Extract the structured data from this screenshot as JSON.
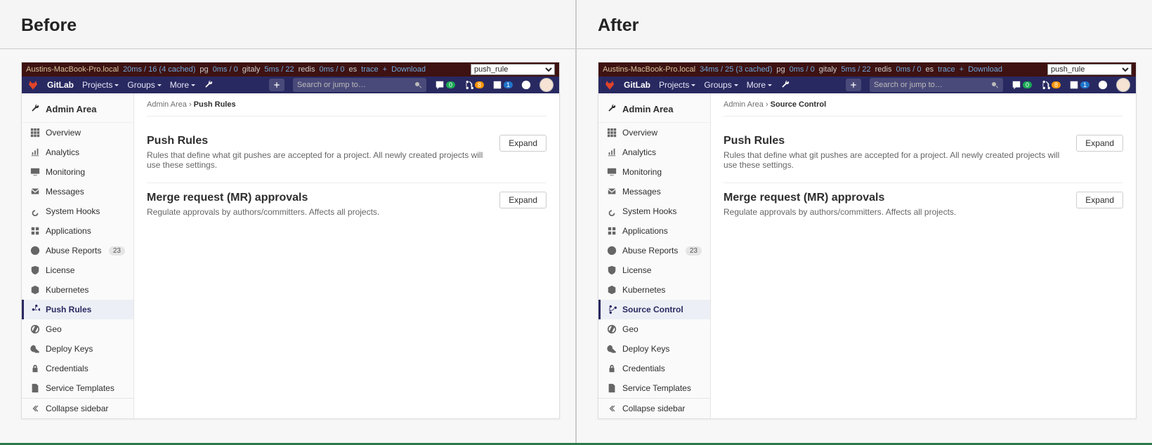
{
  "labels": {
    "before": "Before",
    "after": "After"
  },
  "perf": {
    "host": "Austins-MacBook-Pro.local",
    "before_metrics": "20ms / 16 (4 cached)",
    "after_metrics": "34ms / 25 (3 cached)",
    "pg": "pg",
    "pg_ms": "0ms / 0",
    "gitaly": "gitaly",
    "gitaly_ms": "5ms / 22",
    "redis": "redis",
    "redis_ms": "0ms / 0",
    "es": "es",
    "trace": "trace",
    "plus": "+",
    "download": "Download",
    "combo": "push_rule"
  },
  "nav": {
    "brand": "GitLab",
    "projects": "Projects",
    "groups": "Groups",
    "more": "More",
    "search_placeholder": "Search or jump to…",
    "issues_badge": "0",
    "mr_badge": "8",
    "todos_badge": "1"
  },
  "sidebar": {
    "head": "Admin Area",
    "overview": "Overview",
    "analytics": "Analytics",
    "monitoring": "Monitoring",
    "messages": "Messages",
    "system_hooks": "System Hooks",
    "applications": "Applications",
    "abuse_reports": "Abuse Reports",
    "abuse_badge": "23",
    "license": "License",
    "kubernetes": "Kubernetes",
    "push_rules": "Push Rules",
    "source_control": "Source Control",
    "geo": "Geo",
    "deploy_keys": "Deploy Keys",
    "credentials": "Credentials",
    "service_templates": "Service Templates",
    "collapse": "Collapse sidebar"
  },
  "crumbs": {
    "root": "Admin Area",
    "sep": "›",
    "before_leaf": "Push Rules",
    "after_leaf": "Source Control"
  },
  "sections": {
    "push_title": "Push Rules",
    "push_desc": "Rules that define what git pushes are accepted for a project. All newly created projects will use these settings.",
    "mr_title": "Merge request (MR) approvals",
    "mr_desc": "Regulate approvals by authors/committers. Affects all projects.",
    "expand": "Expand"
  }
}
